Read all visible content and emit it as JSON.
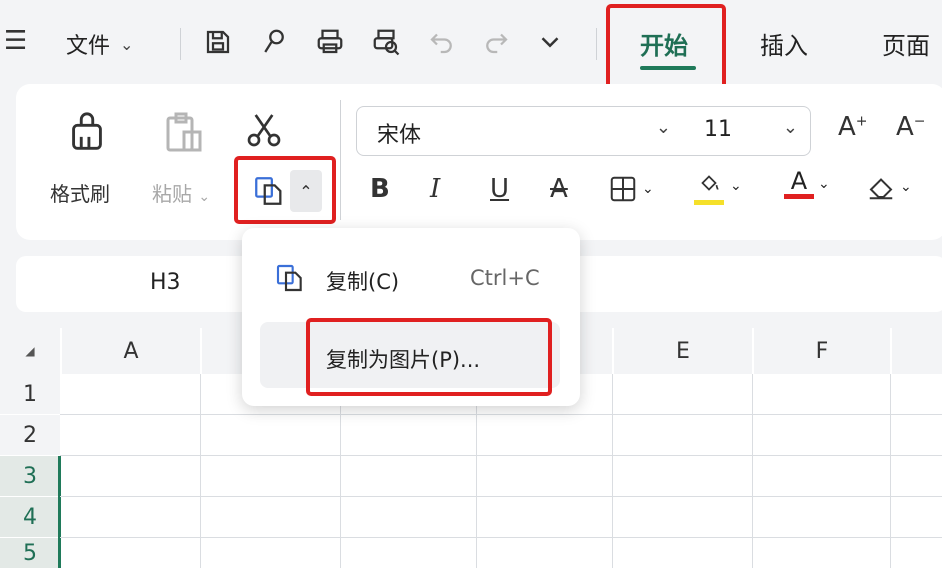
{
  "topbar": {
    "file_label": "文件",
    "tabs": [
      {
        "label": "开始",
        "active": true
      },
      {
        "label": "插入",
        "active": false
      },
      {
        "label": "页面",
        "active": false
      }
    ]
  },
  "ribbon": {
    "format_painter_label": "格式刷",
    "paste_label": "粘贴",
    "font_name": "宋体",
    "font_size": "11"
  },
  "formula_bar": {
    "cell_ref": "H3"
  },
  "sheet": {
    "columns": [
      "A",
      "E",
      "F"
    ],
    "rows": [
      "1",
      "2",
      "3",
      "4",
      "5"
    ],
    "selected_row_color": "#1f7a5a"
  },
  "copy_menu": {
    "items": [
      {
        "label": "复制(C)",
        "shortcut": "Ctrl+C"
      },
      {
        "label": "复制为图片(P)..."
      }
    ]
  },
  "colors": {
    "accent": "#1f7a5a",
    "highlight": "#e02020",
    "fill_yellow": "#f5e02a",
    "font_red": "#e02020"
  }
}
